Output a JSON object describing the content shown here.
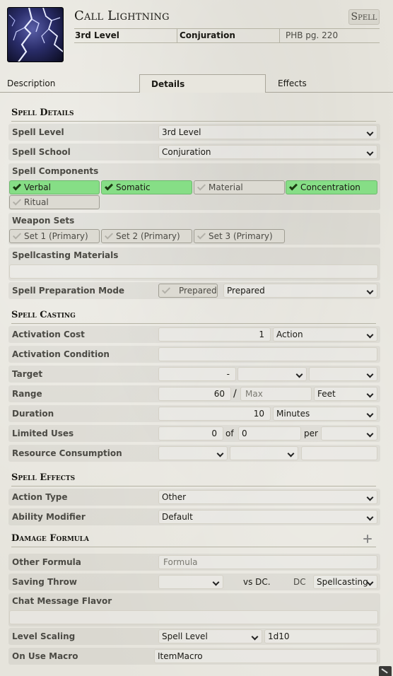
{
  "header": {
    "title": "Call Lightning",
    "item_type": "Spell",
    "summary": {
      "level": "3rd Level",
      "school": "Conjuration",
      "source": "PHB pg. 220"
    }
  },
  "tabs": [
    {
      "label": "Description",
      "active": false
    },
    {
      "label": "Details",
      "active": true
    },
    {
      "label": "Effects",
      "active": false
    }
  ],
  "spell_details": {
    "heading": "Spell Details",
    "level_label": "Spell Level",
    "level_value": "3rd Level",
    "school_label": "Spell School",
    "school_value": "Conjuration",
    "components_label": "Spell Components",
    "components": [
      {
        "label": "Verbal",
        "checked": true
      },
      {
        "label": "Somatic",
        "checked": true
      },
      {
        "label": "Material",
        "checked": false
      },
      {
        "label": "Concentration",
        "checked": true
      },
      {
        "label": "Ritual",
        "checked": false
      }
    ],
    "weapon_sets_label": "Weapon Sets",
    "weapon_sets": [
      {
        "label": "Set 1 (Primary)",
        "checked": false
      },
      {
        "label": "Set 2 (Primary)",
        "checked": false
      },
      {
        "label": "Set 3 (Primary)",
        "checked": false
      }
    ],
    "materials_label": "Spellcasting Materials",
    "materials_value": "",
    "prep_mode_label": "Spell Preparation Mode",
    "prepared_toggle": "Prepared",
    "prep_mode_value": "Prepared"
  },
  "spell_casting": {
    "heading": "Spell Casting",
    "activation_cost_label": "Activation Cost",
    "activation_cost_value": "1",
    "activation_type": "Action",
    "activation_condition_label": "Activation Condition",
    "target_label": "Target",
    "target_value": "-",
    "range_label": "Range",
    "range_value": "60",
    "range_sep": "/",
    "range_max_placeholder": "Max",
    "range_units": "Feet",
    "duration_label": "Duration",
    "duration_value": "10",
    "duration_units": "Minutes",
    "limited_uses_label": "Limited Uses",
    "uses_value": "0",
    "uses_of": "of",
    "uses_max": "0",
    "uses_per": "per",
    "resource_label": "Resource Consumption"
  },
  "spell_effects": {
    "heading": "Spell Effects",
    "action_type_label": "Action Type",
    "action_type_value": "Other",
    "ability_label": "Ability Modifier",
    "ability_value": "Default",
    "damage_heading": "Damage Formula",
    "other_formula_label": "Other Formula",
    "other_formula_placeholder": "Formula",
    "saving_throw_label": "Saving Throw",
    "vs_dc": "vs DC.",
    "dc_label": "DC",
    "dc_value": "Spellcasting",
    "chat_flavor_label": "Chat Message Flavor",
    "level_scaling_label": "Level Scaling",
    "level_scaling_mode": "Spell Level",
    "level_scaling_formula": "1d10",
    "on_use_macro_label": "On Use Macro",
    "on_use_macro_value": "ItemMacro"
  },
  "colors": {
    "checked_green": "#86de86",
    "parchment": "#e6e4dc"
  }
}
